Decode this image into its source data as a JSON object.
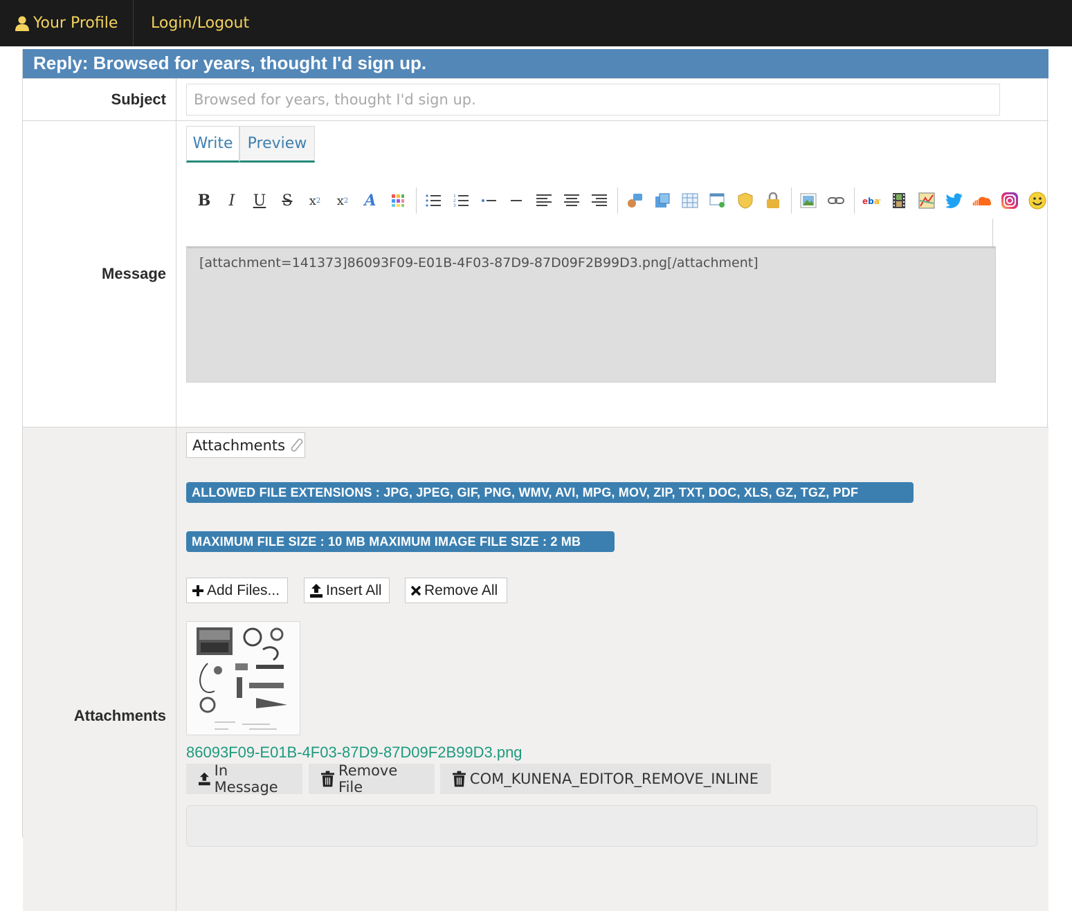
{
  "nav": {
    "profile_label": "Your Profile",
    "login_label": "Login/Logout",
    "accent": "#f3d35e",
    "bg": "#1b1b1b"
  },
  "form": {
    "title": "Reply: Browsed for years, thought I'd sign up.",
    "subject_label": "Subject",
    "subject_placeholder": "Browsed for years, thought I'd sign up.",
    "message_label": "Message",
    "attachments_label": "Attachments"
  },
  "editor": {
    "tabs": [
      {
        "label": "Write"
      },
      {
        "label": "Preview"
      }
    ],
    "toolbar_groups": [
      [
        "bold-icon",
        "italic-icon",
        "underline-icon",
        "strikethrough-icon",
        "subscript-icon",
        "superscript-icon",
        "font-size-icon",
        "color-palette-icon"
      ],
      [
        "unordered-list-icon",
        "ordered-list-icon",
        "list-item-icon",
        "horizontal-rule-icon",
        "align-left-icon",
        "align-center-icon",
        "align-right-icon"
      ],
      [
        "quote-icon",
        "code-icon",
        "table-icon",
        "hide-icon",
        "confidential-icon",
        "lock-icon"
      ],
      [
        "image-icon",
        "link-icon"
      ],
      [
        "ebay-icon",
        "video-icon",
        "map-icon",
        "twitter-icon",
        "soundcloud-icon",
        "instagram-icon",
        "emoticon-icon"
      ]
    ],
    "content": "[attachment=141373]86093F09-E01B-4F03-87D9-87D09F2B99D3.png[/attachment]"
  },
  "attachments": {
    "button_label": "Attachments",
    "allowed_extensions": "ALLOWED FILE EXTENSIONS : JPG, JPEG, GIF, PNG, WMV, AVI, MPG, MOV, ZIP, TXT, DOC, XLS, GZ, TGZ, PDF",
    "max_size": "MAXIMUM FILE SIZE : 10 MB MAXIMUM IMAGE FILE SIZE : 2 MB",
    "add_files_label": "Add Files...",
    "insert_all_label": "Insert All",
    "remove_all_label": "Remove All",
    "file_name": "86093F09-E01B-4F03-87D9-87D09F2B99D3.png",
    "in_message_label": "In Message",
    "remove_file_label": "Remove File",
    "remove_inline_label": "COM_KUNENA_EDITOR_REMOVE_INLINE",
    "badge_color": "#3b7fb0",
    "file_link_color": "#1d9a7d"
  },
  "colors": {
    "header_bar": "#5287b8",
    "tab_underline": "#238a78"
  }
}
